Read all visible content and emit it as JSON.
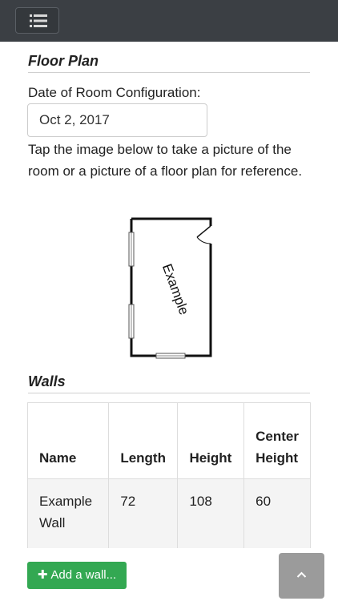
{
  "navbar": {
    "menu_icon": "list-icon"
  },
  "floor_plan": {
    "title": "Floor Plan",
    "date_label": "Date of Room Configuration:",
    "date_value": "Oct 2, 2017",
    "instructions": "Tap the image below to take a picture of the room or a picture of a floor plan for reference.",
    "image_label": "Example"
  },
  "walls": {
    "title": "Walls",
    "columns": [
      "Name",
      "Length",
      "Height",
      "Center Height"
    ],
    "rows": [
      {
        "name": "Example Wall",
        "length": "72",
        "height": "108",
        "center_height": "60"
      }
    ],
    "add_button": "Add a wall..."
  },
  "scroll_top": {
    "icon": "chevron-up-icon"
  },
  "colors": {
    "navbar": "#3b3f44",
    "add_button": "#33a852",
    "scroll_button": "#9b9b9b"
  }
}
